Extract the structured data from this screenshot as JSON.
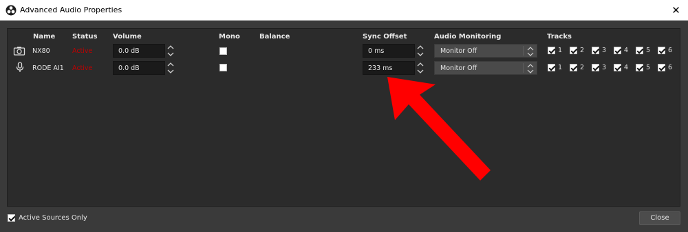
{
  "window": {
    "title": "Advanced Audio Properties",
    "close_glyph": "✕"
  },
  "headers": {
    "name": "Name",
    "status": "Status",
    "volume": "Volume",
    "mono": "Mono",
    "balance": "Balance",
    "sync_offset": "Sync Offset",
    "audio_monitoring": "Audio Monitoring",
    "tracks": "Tracks"
  },
  "rows": [
    {
      "icon": "camera-icon",
      "name": "NX80",
      "status": "Active",
      "volume": "0.0 dB",
      "mono": false,
      "sync_offset": "0 ms",
      "monitoring": "Monitor Off",
      "tracks": [
        {
          "label": "1",
          "checked": true
        },
        {
          "label": "2",
          "checked": true
        },
        {
          "label": "3",
          "checked": true
        },
        {
          "label": "4",
          "checked": true
        },
        {
          "label": "5",
          "checked": true
        },
        {
          "label": "6",
          "checked": true
        }
      ]
    },
    {
      "icon": "microphone-icon",
      "name": "RODE AI1",
      "status": "Active",
      "volume": "0.0 dB",
      "mono": false,
      "sync_offset": "233 ms",
      "monitoring": "Monitor Off",
      "tracks": [
        {
          "label": "1",
          "checked": true
        },
        {
          "label": "2",
          "checked": true
        },
        {
          "label": "3",
          "checked": true
        },
        {
          "label": "4",
          "checked": true
        },
        {
          "label": "5",
          "checked": true
        },
        {
          "label": "6",
          "checked": true
        }
      ]
    }
  ],
  "footer": {
    "active_sources_only": "Active Sources Only",
    "active_sources_checked": true,
    "close_label": "Close"
  },
  "colors": {
    "status_active": "#c00000",
    "annotation_arrow": "#ff0000"
  }
}
